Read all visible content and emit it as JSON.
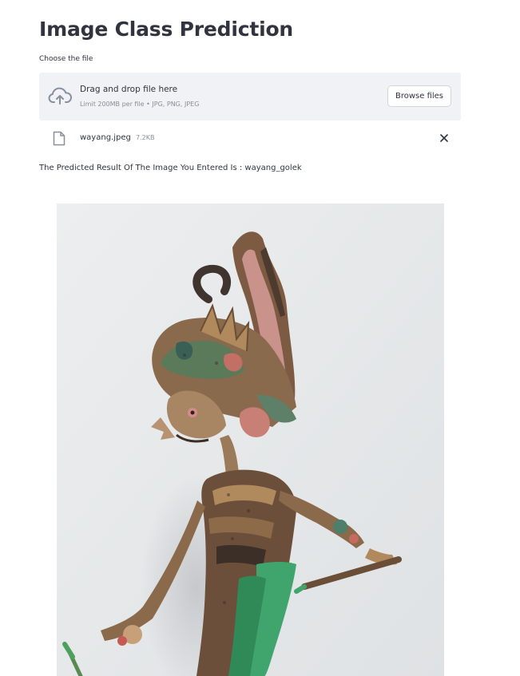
{
  "page": {
    "title": "Image Class Prediction"
  },
  "uploader": {
    "label": "Choose the file",
    "drop_text": "Drag and drop file here",
    "limit_text": "Limit 200MB per file • JPG, PNG, JPEG",
    "browse_label": "Browse files",
    "upload_icon": "cloud-upload-icon"
  },
  "uploaded_file": {
    "name": "wayang.jpeg",
    "size": "7.2KB",
    "icon": "file-icon",
    "remove_icon": "close-icon"
  },
  "result": {
    "text": "The Predicted Result Of The Image You Entered Is : wayang_golek"
  },
  "colors": {
    "dropzone_bg": "#f0f2f6",
    "text": "#31333f",
    "muted": "#8a8d97",
    "icon": "#8a8fa0"
  }
}
